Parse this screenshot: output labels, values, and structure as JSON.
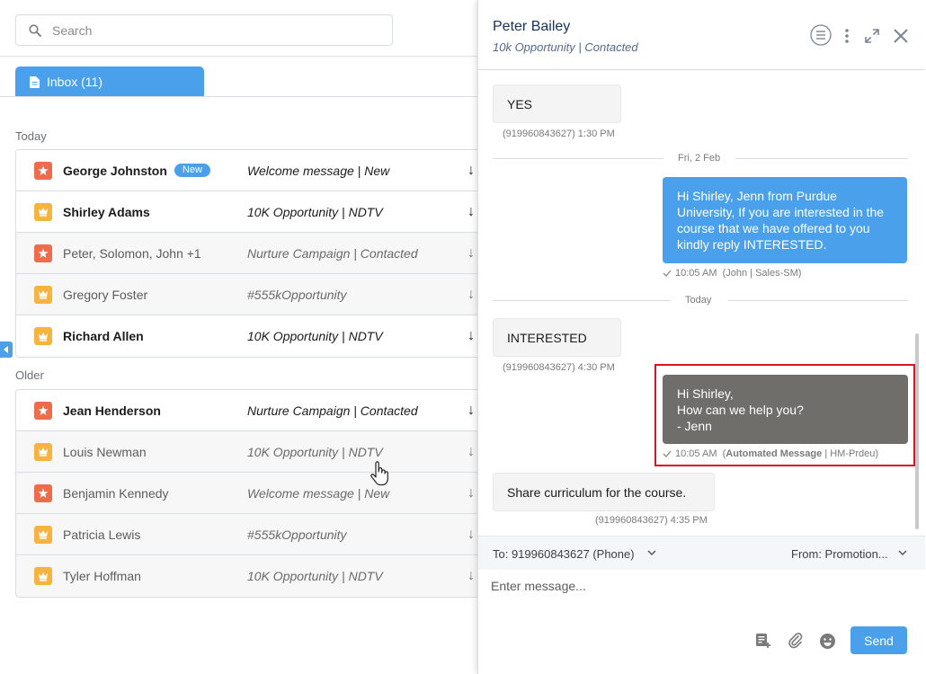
{
  "search": {
    "placeholder": "Search"
  },
  "inbox_tab": {
    "label": "Inbox (11)"
  },
  "sections": {
    "today": "Today",
    "older": "Older"
  },
  "today_rows": [
    {
      "name": "George Johnston",
      "badge": "New",
      "subject": "Welcome message | New",
      "icon": "star-icon",
      "unread": true
    },
    {
      "name": "Shirley Adams",
      "subject": "10K Opportunity | NDTV",
      "icon": "crown-icon",
      "unread": true
    },
    {
      "name": "Peter, Solomon, John +1",
      "subject": "Nurture Campaign | Contacted",
      "icon": "star-icon",
      "unread": false
    },
    {
      "name": "Gregory Foster",
      "subject": "#555kOpportunity",
      "icon": "crown-icon",
      "unread": false
    },
    {
      "name": "Richard Allen",
      "subject": "10K Opportunity | NDTV",
      "icon": "crown-icon",
      "unread": true
    }
  ],
  "older_rows": [
    {
      "name": "Jean Henderson",
      "subject": "Nurture Campaign | Contacted",
      "icon": "star-icon",
      "unread": true
    },
    {
      "name": "Louis Newman",
      "subject": "10K Opportunity | NDTV",
      "icon": "crown-icon",
      "unread": false
    },
    {
      "name": "Benjamin Kennedy",
      "subject": "Welcome message | New",
      "icon": "star-icon",
      "unread": false
    },
    {
      "name": "Patricia Lewis",
      "subject": "#555kOpportunity",
      "icon": "crown-icon",
      "unread": false
    },
    {
      "name": "Tyler Hoffman",
      "subject": "10K Opportunity | NDTV",
      "icon": "crown-icon",
      "unread": false
    }
  ],
  "arrow_glyph": "↓",
  "conversation": {
    "title": "Peter Bailey",
    "subtitle": "10k Opportunity | Contacted",
    "msg1": {
      "text": "YES",
      "meta": "(919960843627)  1:30 PM"
    },
    "date1": "Fri, 2 Feb",
    "msg2": {
      "text": "Hi Shirley, Jenn from Purdue University, If you are interested in the course that we have offered to you kindly reply INTERESTED.",
      "meta_time": "10:05 AM",
      "meta_rest": "(John | Sales-SM)"
    },
    "date2": "Today",
    "msg3": {
      "text": "INTERESTED",
      "meta": "(919960843627)  4:30 PM"
    },
    "msg4": {
      "line1": "Hi Shirley,",
      "line2": "How can we help you?",
      "line3": "- Jenn",
      "meta_time": "10:05 AM",
      "meta_bold": "Automated Message",
      "meta_rest": "| HM-Prdeu)",
      "meta_open": "("
    },
    "msg5": {
      "text": "Share curriculum for the course.",
      "meta": "(919960843627)  4:35 PM"
    }
  },
  "compose": {
    "to": "To: 919960843627 (Phone)",
    "from": "From: Promotion...",
    "placeholder": "Enter message...",
    "send_label": "Send"
  },
  "colors": {
    "accent": "#4aa0ea",
    "star": "#f06a4c",
    "crown": "#f7b33f",
    "automated": "#706e6b",
    "highlight": "#d9151d"
  }
}
